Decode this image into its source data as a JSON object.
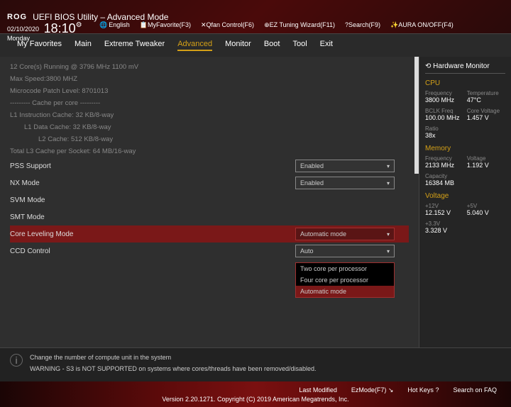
{
  "header": {
    "logo": "ROG",
    "title": "UEFI BIOS Utility – Advanced Mode"
  },
  "datetime": {
    "date": "02/10/2020",
    "day": "Monday",
    "time": "18:10"
  },
  "topbar": {
    "lang": "English",
    "fav": "MyFavorite(F3)",
    "qfan": "Qfan Control(F6)",
    "ez": "EZ Tuning Wizard(F11)",
    "search": "Search(F9)",
    "aura": "AURA ON/OFF(F4)"
  },
  "tabs": [
    "My Favorites",
    "Main",
    "Extreme Tweaker",
    "Advanced",
    "Monitor",
    "Boot",
    "Tool",
    "Exit"
  ],
  "active_tab": "Advanced",
  "info": [
    "12 Core(s) Running @ 3796 MHz  1100 mV",
    "Max Speed:3800 MHZ",
    "Microcode Patch Level: 8701013",
    "--------- Cache per core ---------",
    "L1 Instruction Cache: 32 KB/8-way",
    "L1 Data Cache: 32 KB/8-way",
    "L2 Cache: 512 KB/8-way",
    "Total L3 Cache per Socket: 64 MB/16-way"
  ],
  "settings": {
    "pss": {
      "label": "PSS Support",
      "value": "Enabled"
    },
    "nx": {
      "label": "NX Mode",
      "value": "Enabled"
    },
    "svm": {
      "label": "SVM Mode",
      "value": ""
    },
    "smt": {
      "label": "SMT Mode",
      "value": ""
    },
    "core": {
      "label": "Core Leveling Mode",
      "value": "Automatic mode"
    },
    "ccd": {
      "label": "CCD Control",
      "value": "Auto"
    }
  },
  "dropdown_options": [
    "Two core per processor",
    "Four core per processor",
    "Automatic mode"
  ],
  "help": {
    "line1": "Change the number of compute unit in the system",
    "line2": "WARNING - S3 is NOT SUPPORTED on systems where cores/threads have been removed/disabled."
  },
  "hw": {
    "title": "Hardware Monitor",
    "cpu": {
      "title": "CPU",
      "freq_l": "Frequency",
      "freq_v": "3800 MHz",
      "temp_l": "Temperature",
      "temp_v": "47°C",
      "bclk_l": "BCLK Freq",
      "bclk_v": "100.00 MHz",
      "cv_l": "Core Voltage",
      "cv_v": "1.457 V",
      "ratio_l": "Ratio",
      "ratio_v": "38x"
    },
    "mem": {
      "title": "Memory",
      "freq_l": "Frequency",
      "freq_v": "2133 MHz",
      "volt_l": "Voltage",
      "volt_v": "1.192 V",
      "cap_l": "Capacity",
      "cap_v": "16384 MB"
    },
    "volt": {
      "title": "Voltage",
      "p12_l": "+12V",
      "p12_v": "12.152 V",
      "p5_l": "+5V",
      "p5_v": "5.040 V",
      "p33_l": "+3.3V",
      "p33_v": "3.328 V"
    }
  },
  "footer": {
    "lastmod": "Last Modified",
    "ezmode": "EzMode(F7)",
    "hotkeys": "Hot Keys",
    "faq": "Search on FAQ",
    "copyright": "Version 2.20.1271. Copyright (C) 2019 American Megatrends, Inc."
  }
}
